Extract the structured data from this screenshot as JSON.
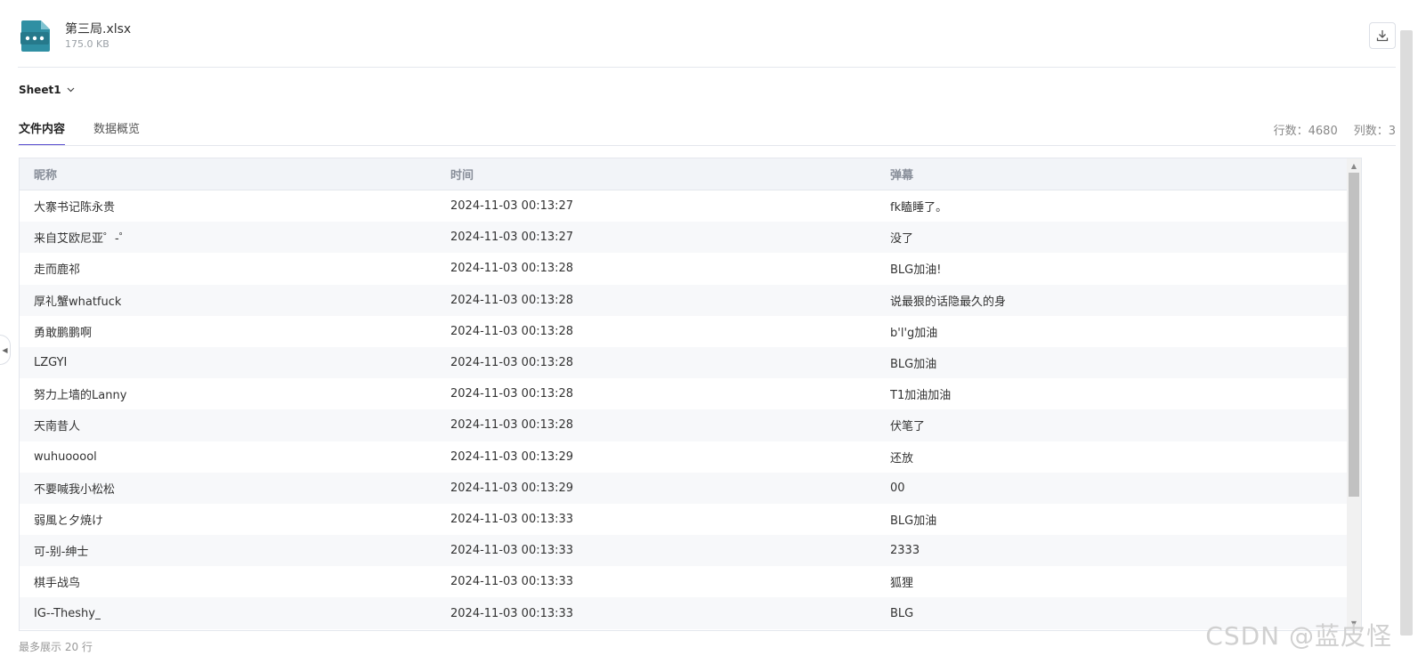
{
  "file": {
    "name": "第三局.xlsx",
    "size": "175.0 KB",
    "icon": "spreadsheet-file-icon",
    "accent": "#2f8fa3"
  },
  "sheet": {
    "selected": "Sheet1"
  },
  "tabs": [
    {
      "label": "文件内容",
      "active": true
    },
    {
      "label": "数据概览",
      "active": false
    }
  ],
  "stats": {
    "rows_label": "行数：4680",
    "cols_label": "列数：3"
  },
  "table": {
    "columns": [
      "昵称",
      "时间",
      "弹幕"
    ],
    "rows": [
      [
        "大寨书记陈永贵",
        "2024-11-03 00:13:27",
        "fk瞌睡了。"
      ],
      [
        "来自艾欧尼亚゜-゜",
        "2024-11-03 00:13:27",
        "没了"
      ],
      [
        "走而鹿祁",
        "2024-11-03 00:13:28",
        "BLG加油!"
      ],
      [
        "厚礼蟹whatfuck",
        "2024-11-03 00:13:28",
        "说最狠的话隐最久的身"
      ],
      [
        "勇敢鹏鹏啊",
        "2024-11-03 00:13:28",
        "b'l'g加油"
      ],
      [
        "LZGYI",
        "2024-11-03 00:13:28",
        "BLG加油"
      ],
      [
        "努力上墙的Lanny",
        "2024-11-03 00:13:28",
        "T1加油加油"
      ],
      [
        "天南昔人",
        "2024-11-03 00:13:28",
        "伏笔了"
      ],
      [
        "wuhuooool",
        "2024-11-03 00:13:29",
        "还放"
      ],
      [
        "不要喊我小松松",
        "2024-11-03 00:13:29",
        "00"
      ],
      [
        "弱風と夕焼け",
        "2024-11-03 00:13:33",
        "BLG加油"
      ],
      [
        "可-别-绅士",
        "2024-11-03 00:13:33",
        "2333"
      ],
      [
        "棋手战鸟",
        "2024-11-03 00:13:33",
        "狐狸"
      ],
      [
        "IG--Theshy_",
        "2024-11-03 00:13:33",
        "BLG"
      ]
    ]
  },
  "footer_note": "最多展示 20 行",
  "watermark": "CSDN @蓝皮怪",
  "colors": {
    "tab_active": "#5b4fcf",
    "header_bg": "#f2f4f8",
    "stripe": "#f7f8fa"
  }
}
